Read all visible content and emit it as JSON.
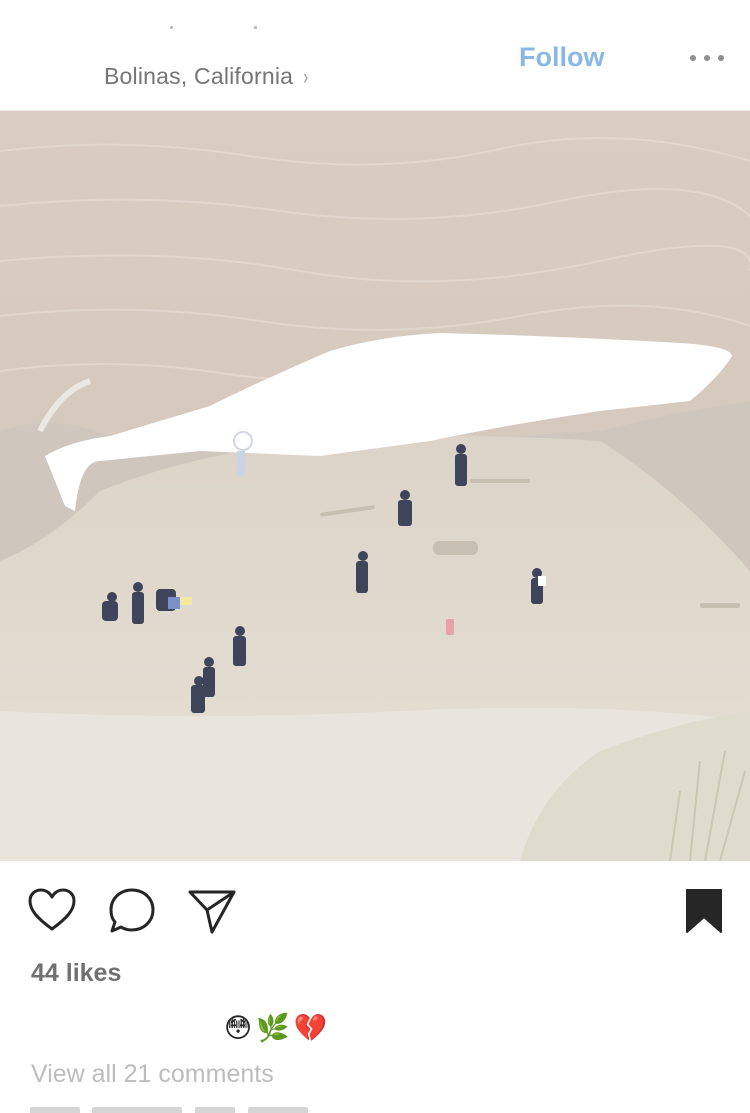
{
  "header": {
    "location": "Bolinas, California",
    "location_chevron": "›",
    "follow_label": "Follow",
    "more_icon": "more-horizontal-icon"
  },
  "post": {
    "image_icon": "beach-photo"
  },
  "actions": {
    "like_icon": "heart-outline-icon",
    "comment_icon": "comment-bubble-icon",
    "share_icon": "paper-plane-icon",
    "save_icon": "bookmark-filled-icon"
  },
  "likes": "44 likes",
  "caption": {
    "emojis": "😳🌿💔"
  },
  "comments": {
    "view_all": "View all 21 comments"
  },
  "colors": {
    "follow": "#8ab8e6",
    "location": "#757575",
    "muted": "#bdbdbd",
    "icons": "#262626",
    "likes": "#707070"
  }
}
